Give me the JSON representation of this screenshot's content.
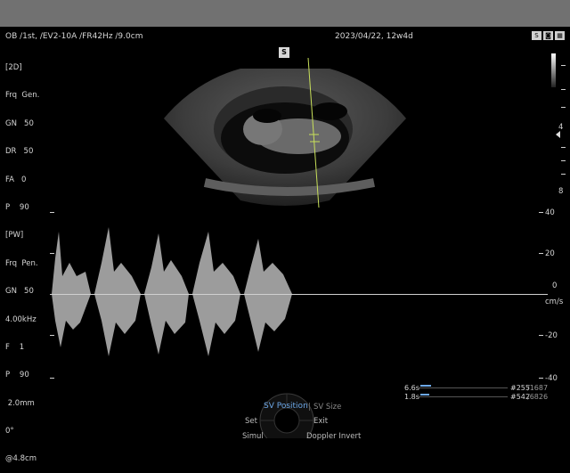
{
  "header": {
    "left": "OB /1st, /EV2-10A /FR42Hz /9.0cm",
    "date": "2023/04/22, 12w4d"
  },
  "params_2d": [
    "[2D]",
    "Frq  Gen.",
    "GN   50",
    "DR   50",
    "FA   0",
    "P    90"
  ],
  "params_pw": [
    "[PW]",
    "Frq  Pen.",
    "GN   50",
    "4.00kHz",
    "F    1",
    "P    90",
    " 2.0mm",
    "0°",
    "@4.8cm"
  ],
  "sector_badge": "S",
  "depth_scale": {
    "marks": [
      "4",
      "8"
    ]
  },
  "spectrum_scale": {
    "labels": [
      "40",
      "20",
      "0",
      "-20",
      "-40"
    ],
    "unit": "cm/s"
  },
  "cine": {
    "row1_time": "6.6s",
    "row1_frame": "#255",
    "row1_total": "/1687",
    "row2_time": "1.8s",
    "row2_frame": "#542",
    "row2_total": "/6826"
  },
  "menu": {
    "active": "SV Position",
    "secondary": "SV Size",
    "set": "Set",
    "exit": "Exit",
    "simul": "Simul",
    "doppler_invert": "Doppler Invert"
  },
  "top_icons": [
    "S-icon",
    "camera-icon",
    "grid-icon"
  ],
  "colors": {
    "cursor_line": "#c8e05a",
    "menu_active": "#6da8e8",
    "top_bar": "#717171"
  }
}
